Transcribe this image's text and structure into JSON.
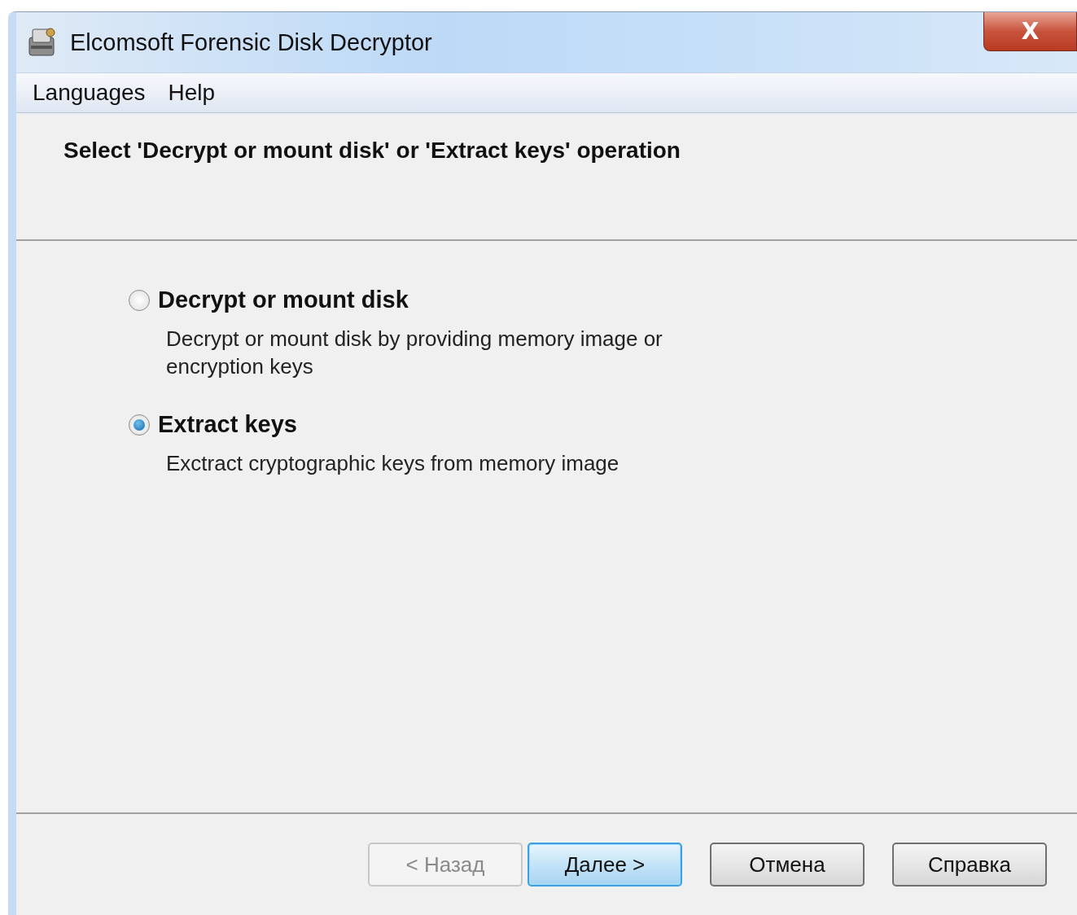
{
  "window": {
    "title": "Elcomsoft Forensic Disk Decryptor",
    "close": "X"
  },
  "menu": [
    {
      "label": "Languages"
    },
    {
      "label": "Help"
    }
  ],
  "header": {
    "title": "Select 'Decrypt or mount disk' or 'Extract keys' operation"
  },
  "options": [
    {
      "label": "Decrypt or mount disk",
      "description": "Decrypt or mount disk by providing memory image or encryption keys",
      "selected": false
    },
    {
      "label": "Extract keys",
      "description": "Exctract cryptographic keys from memory image",
      "selected": true
    }
  ],
  "buttons": [
    {
      "label": "< Назад",
      "disabled": true,
      "default": false
    },
    {
      "label": "Далее >",
      "disabled": false,
      "default": true
    },
    {
      "label": "Отмена",
      "disabled": false,
      "default": false
    },
    {
      "label": "Справка",
      "disabled": false,
      "default": false
    }
  ]
}
